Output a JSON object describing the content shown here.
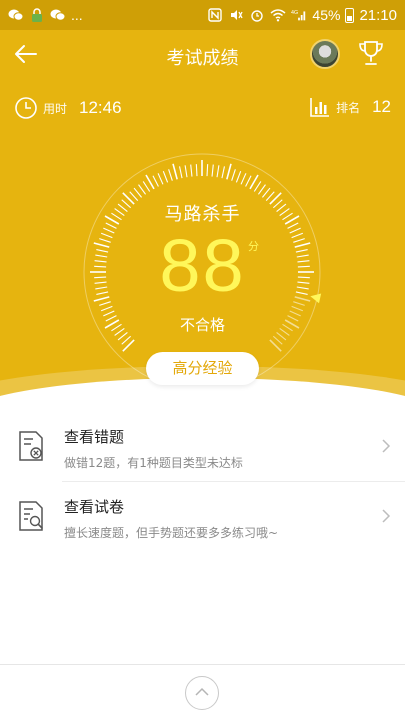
{
  "status_bar": {
    "left_icons": [
      "wechat-icon",
      "lock-app-icon",
      "wechat-icon"
    ],
    "dots": "...",
    "battery": "45%",
    "time": "21:10",
    "network": "4G"
  },
  "header": {
    "title": "考试成绩"
  },
  "stats": {
    "time_label": "用时",
    "time_value": "12:46",
    "rank_label": "排名",
    "rank_value": "12"
  },
  "gauge": {
    "title": "马路杀手",
    "score": "88",
    "unit": "分",
    "result": "不合格",
    "score_fraction": 0.88
  },
  "experience_button": "高分经验",
  "list": [
    {
      "title": "查看错题",
      "subtitle": "做错12题，有1种题目类型未达标",
      "icon": "wrong-questions-icon"
    },
    {
      "title": "查看试卷",
      "subtitle": "擅长速度题，但手势题还要多多练习哦~",
      "icon": "view-paper-icon"
    }
  ],
  "colors": {
    "primary": "#e6b40f",
    "status_bar": "#cf9f06",
    "score": "#fff75a",
    "button_text": "#e3a80a"
  }
}
